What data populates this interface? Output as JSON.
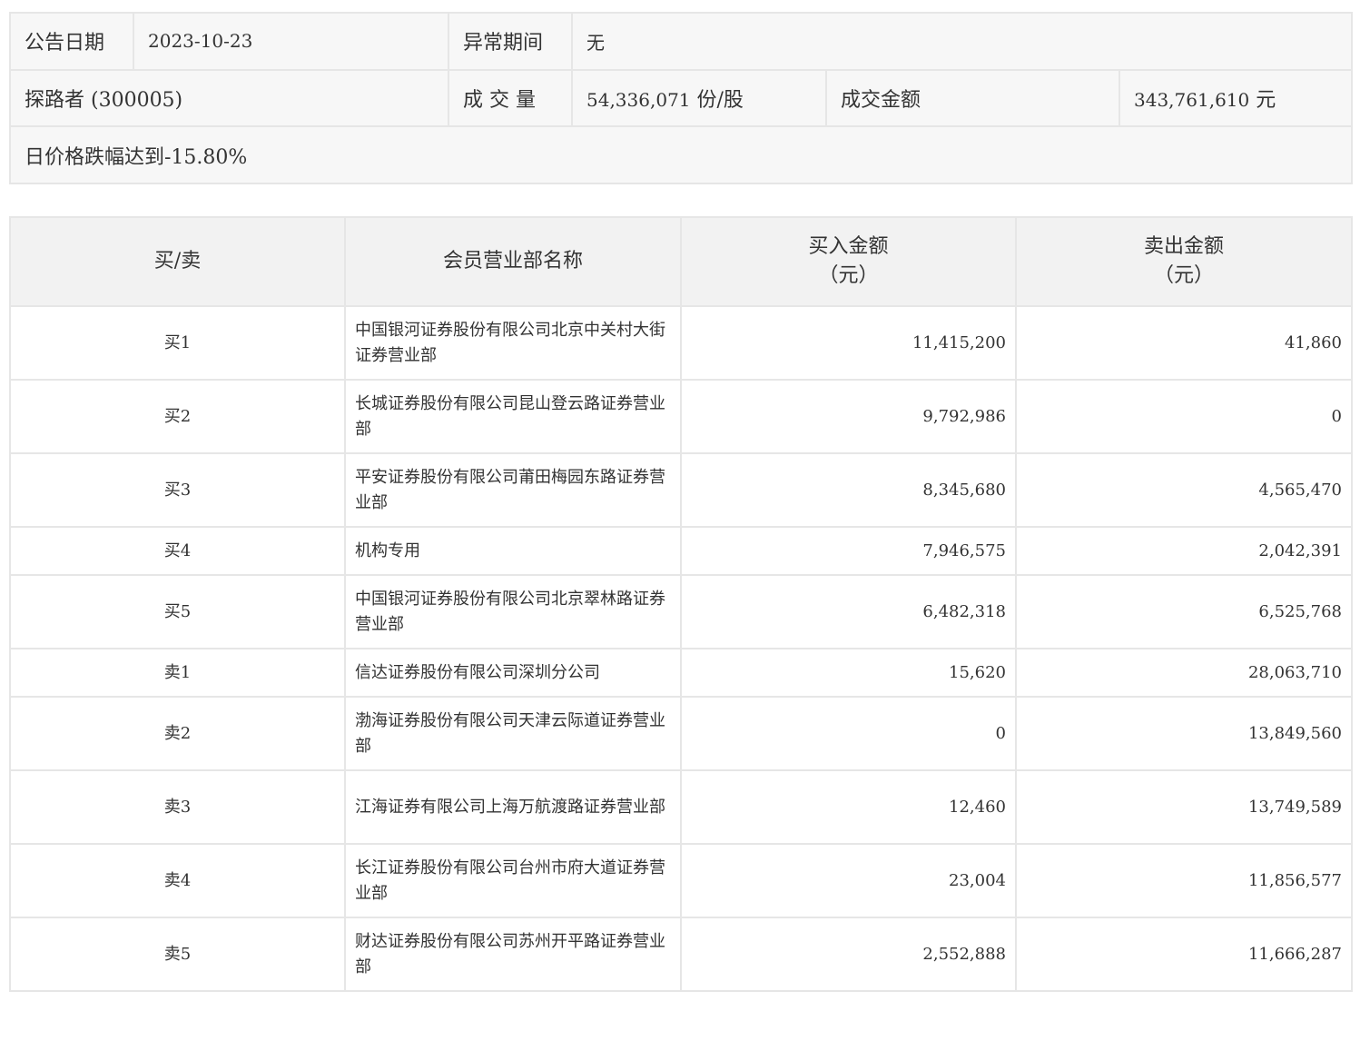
{
  "summary": {
    "announce_date_label": "公告日期",
    "announce_date_value": "2023-10-23",
    "abnormal_period_label": "异常期间",
    "abnormal_period_value": "无",
    "stock": "探路者 (300005)",
    "volume_label": "成 交 量",
    "volume_value": "54,336,071",
    "volume_unit": " 份/股",
    "amount_label": "成交金额",
    "amount_value": "343,761,610",
    "amount_unit": " 元",
    "reason": "日价格跌幅达到-15.80%"
  },
  "table": {
    "headers": {
      "side": "买/卖",
      "name": "会员营业部名称",
      "buy_line1": "买入金额",
      "buy_line2": "（元）",
      "sell_line1": "卖出金额",
      "sell_line2": "（元）"
    },
    "rows": [
      {
        "side": "买1",
        "name": "中国银河证券股份有限公司北京中关村大街证券营业部",
        "buy": "11,415,200",
        "sell": "41,860"
      },
      {
        "side": "买2",
        "name": "长城证券股份有限公司昆山登云路证券营业部",
        "buy": "9,792,986",
        "sell": "0"
      },
      {
        "side": "买3",
        "name": "平安证券股份有限公司莆田梅园东路证券营业部",
        "buy": "8,345,680",
        "sell": "4,565,470"
      },
      {
        "side": "买4",
        "name": "机构专用",
        "buy": "7,946,575",
        "sell": "2,042,391"
      },
      {
        "side": "买5",
        "name": "中国银河证券股份有限公司北京翠林路证券营业部",
        "buy": "6,482,318",
        "sell": "6,525,768"
      },
      {
        "side": "卖1",
        "name": "信达证券股份有限公司深圳分公司",
        "buy": "15,620",
        "sell": "28,063,710"
      },
      {
        "side": "卖2",
        "name": "渤海证券股份有限公司天津云际道证券营业部",
        "buy": "0",
        "sell": "13,849,560"
      },
      {
        "side": "卖3",
        "name": "江海证券有限公司上海万航渡路证券营业部",
        "buy": "12,460",
        "sell": "13,749,589"
      },
      {
        "side": "卖4",
        "name": "长江证券股份有限公司台州市府大道证券营业部",
        "buy": "23,004",
        "sell": "11,856,577"
      },
      {
        "side": "卖5",
        "name": "财达证券股份有限公司苏州开平路证券营业部",
        "buy": "2,552,888",
        "sell": "11,666,287"
      }
    ]
  }
}
